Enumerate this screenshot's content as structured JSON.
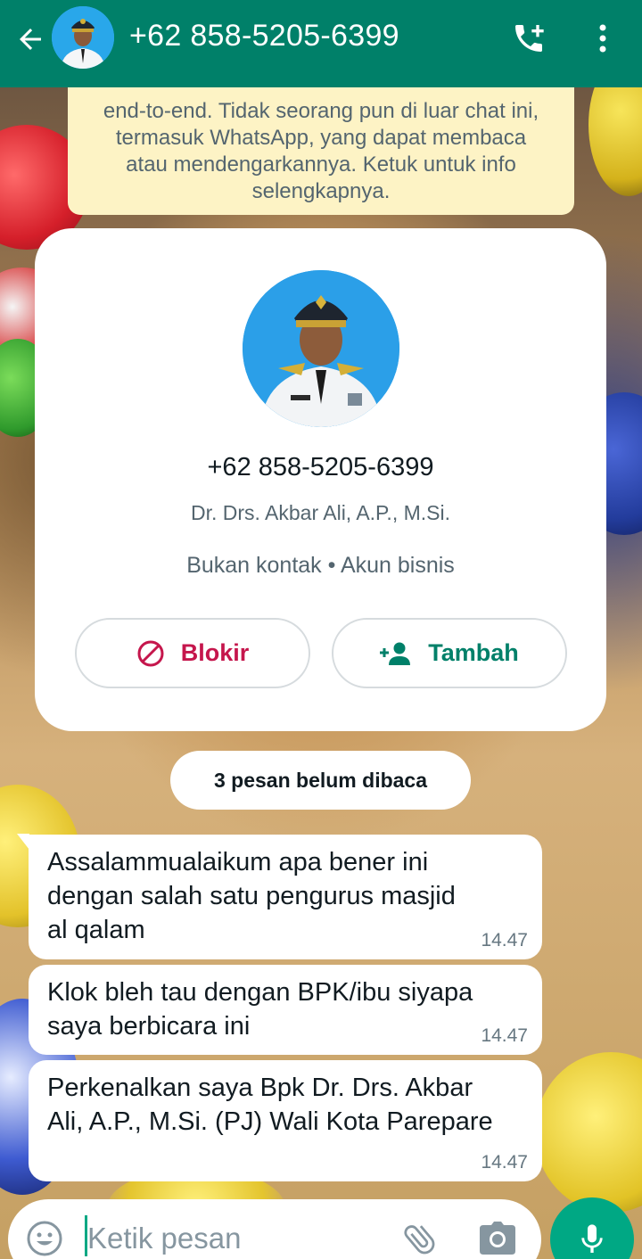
{
  "header": {
    "contact_title": "+62 858-5205-6399",
    "back_icon": "arrow-back-icon",
    "call_icon": "add-call-icon",
    "menu_icon": "more-vert-icon"
  },
  "encryption_notice": {
    "lines": [
      "end-to-end. Tidak seorang pun di luar chat ini,",
      "termasuk WhatsApp, yang dapat membaca",
      "atau mendengarkannya. Ketuk untuk info",
      "selengkapnya."
    ]
  },
  "profile_card": {
    "phone": "+62 858-5205-6399",
    "name": "Dr. Drs. Akbar Ali, A.P., M.Si.",
    "status": "Bukan kontak • Akun bisnis",
    "block_label": "Blokir",
    "add_label": "Tambah"
  },
  "unread_banner": "3 pesan belum dibaca",
  "messages": [
    {
      "text": "Assalammualaikum apa bener ini\ndengan salah satu pengurus masjid\nal qalam",
      "time": "14.47"
    },
    {
      "text": "Klok bleh tau dengan BPK/ibu siyapa\nsaya berbicara ini",
      "time": "14.47"
    },
    {
      "text": "Perkenalkan saya Bpk Dr. Drs. Akbar\nAli, A.P., M.Si. (PJ) Wali Kota Parepare",
      "time": "14.47"
    }
  ],
  "composer": {
    "placeholder": "Ketik pesan",
    "value": ""
  },
  "colors": {
    "header": "#008069",
    "accent": "#00a884",
    "block": "#c5164c",
    "notice_bg": "#fdf3c5"
  }
}
